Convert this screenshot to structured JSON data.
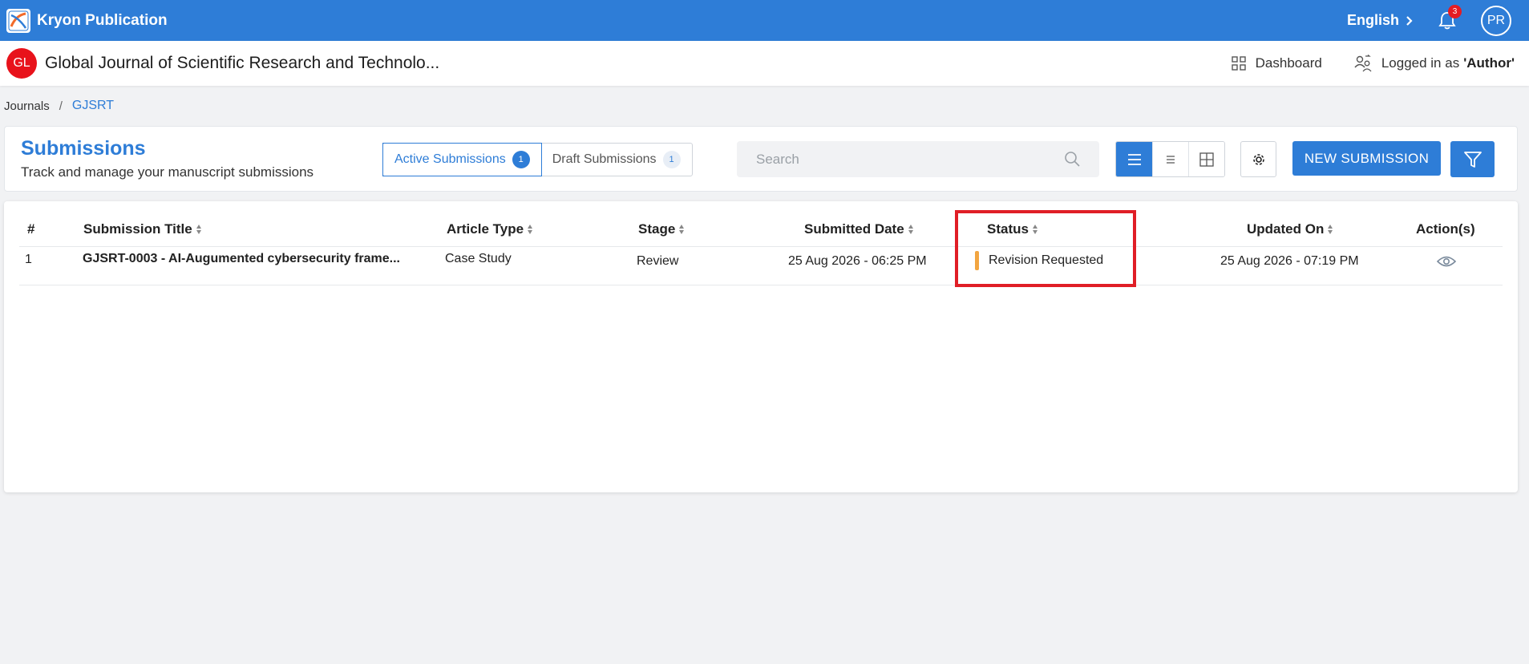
{
  "app": {
    "name": "Kryon Publication",
    "language": "English",
    "notification_count": "3",
    "user_initials": "PR"
  },
  "journal": {
    "logo_initials": "GL",
    "title": "Global Journal of Scientific Research and Technolo...",
    "dashboard_label": "Dashboard",
    "logged_in_prefix": "Logged in as",
    "logged_in_role": "'Author'"
  },
  "breadcrumb": {
    "items": [
      "Journals",
      "GJSRT"
    ],
    "separator": "/"
  },
  "submissions": {
    "title": "Submissions",
    "subtitle": "Track and manage your manuscript submissions",
    "tabs": [
      {
        "label": "Active Submissions",
        "count": "1"
      },
      {
        "label": "Draft Submissions",
        "count": "1"
      }
    ],
    "search_placeholder": "Search",
    "new_button": "NEW SUBMISSION"
  },
  "table": {
    "columns": [
      "#",
      "Submission Title",
      "Article Type",
      "Stage",
      "Submitted Date",
      "Status",
      "Updated On",
      "Action(s)"
    ],
    "rows": [
      {
        "num": "1",
        "title": "GJSRT-0003 - AI-Augumented cybersecurity frame...",
        "article_type": "Case Study",
        "stage": "Review",
        "submitted": "25 Aug 2026 - 06:25 PM",
        "status": "Revision Requested",
        "updated": "25 Aug 2026 - 07:19 PM"
      }
    ]
  },
  "colors": {
    "primary": "#2e7dd7",
    "status_revision": "#f2a541",
    "highlight": "#e01e26",
    "journal_logo": "#e8121b"
  }
}
